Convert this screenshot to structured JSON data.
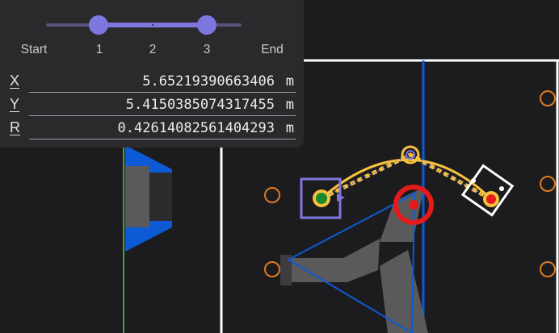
{
  "timeline": {
    "marks": [
      "Start",
      "1",
      "2",
      "3",
      "End"
    ],
    "range": [
      0,
      4
    ],
    "selected_start": 1,
    "selected_end": 3,
    "ticks": [
      2
    ]
  },
  "position": {
    "x": {
      "label": "X",
      "value": "5.65219390663406",
      "unit": "m"
    },
    "y": {
      "label": "Y",
      "value": "5.4150385074317455",
      "unit": "m"
    },
    "r": {
      "label": "R",
      "value": "0.42614082561404293",
      "unit": "m"
    }
  },
  "colors": {
    "background": "#1c1c1e",
    "panel": "#2a2a2d",
    "accent": "#7f77e0",
    "field_line": "#ffffff",
    "alliance_blue": "#0d5ad6",
    "path": "#f6c23e",
    "waypoint_ring": "#e07a1f",
    "robot_red": "#e31b1b",
    "start_point": "#1a8a2e",
    "structure_gray": "#5a5a5c"
  },
  "icons": {
    "start_marker": "green-dot-in-purple-square",
    "end_marker": "red-dot-in-white-square",
    "waypoint": "orange-ring"
  }
}
